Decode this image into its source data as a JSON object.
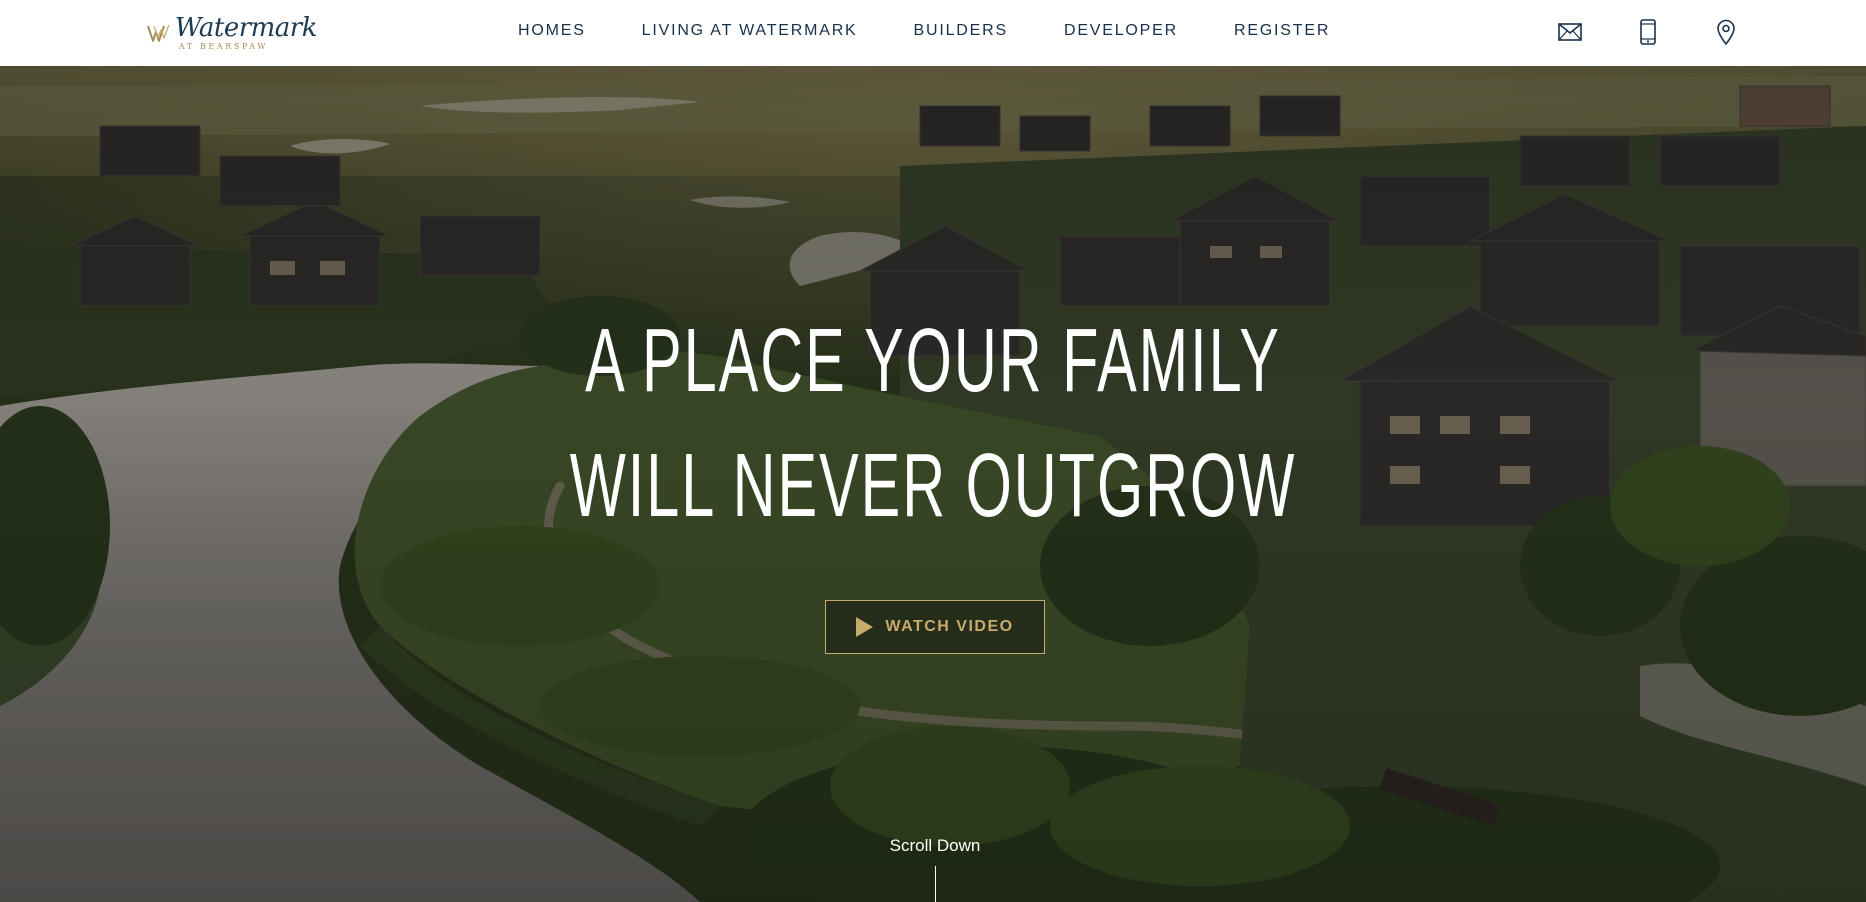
{
  "brand": {
    "name": "Watermark",
    "tagline": "AT BEARSPAW"
  },
  "nav": {
    "items": [
      {
        "label": "HOMES"
      },
      {
        "label": "LIVING AT WATERMARK"
      },
      {
        "label": "BUILDERS"
      },
      {
        "label": "DEVELOPER"
      },
      {
        "label": "REGISTER"
      }
    ]
  },
  "header_icons": [
    "mail-icon",
    "phone-icon",
    "location-pin-icon"
  ],
  "hero": {
    "headline_line1": "A PLACE YOUR FAMILY",
    "headline_line2": "WILL NEVER OUTGROW",
    "watch_video_label": "WATCH VIDEO",
    "scroll_label": "Scroll Down"
  },
  "colors": {
    "navy": "#18304a",
    "gold": "#c7ab6c",
    "white": "#ffffff"
  }
}
